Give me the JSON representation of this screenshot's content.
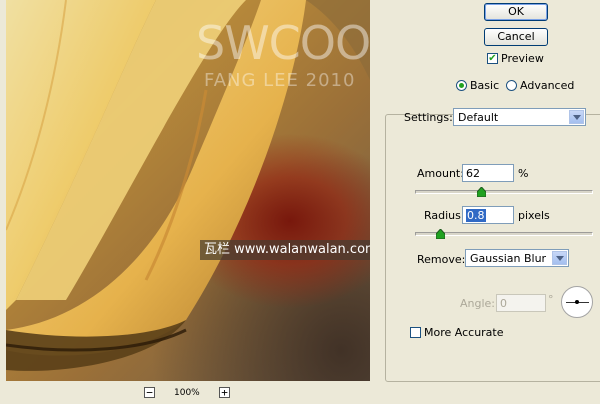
{
  "buttons": {
    "ok": "OK",
    "cancel": "Cancel"
  },
  "preview": {
    "label": "Preview",
    "checked": true
  },
  "mode": {
    "basic": "Basic",
    "advanced": "Advanced",
    "selected": "basic"
  },
  "settings": {
    "label": "Settings:",
    "value": "Default"
  },
  "amount": {
    "label": "Amount:",
    "value": "62",
    "unit": "%",
    "slider_fraction": 0.34
  },
  "radius": {
    "label": "Radius:",
    "value": "0.8",
    "unit": "pixels",
    "slider_fraction": 0.08
  },
  "remove": {
    "label": "Remove:",
    "value": "Gaussian Blur"
  },
  "angle": {
    "label": "Angle:",
    "value": "0",
    "unit": "°"
  },
  "more_accurate": {
    "label": "More Accurate",
    "checked": false
  },
  "zoom": {
    "level": "100%",
    "minus": "−",
    "plus": "+"
  },
  "watermarks": {
    "line1": "SWCOOL",
    "line2": "FANG LEE 2010",
    "line3": "瓦栏 www.walanwalan.com"
  },
  "colors": {
    "accent": "#316ac5",
    "checkmark": "#21a121"
  }
}
